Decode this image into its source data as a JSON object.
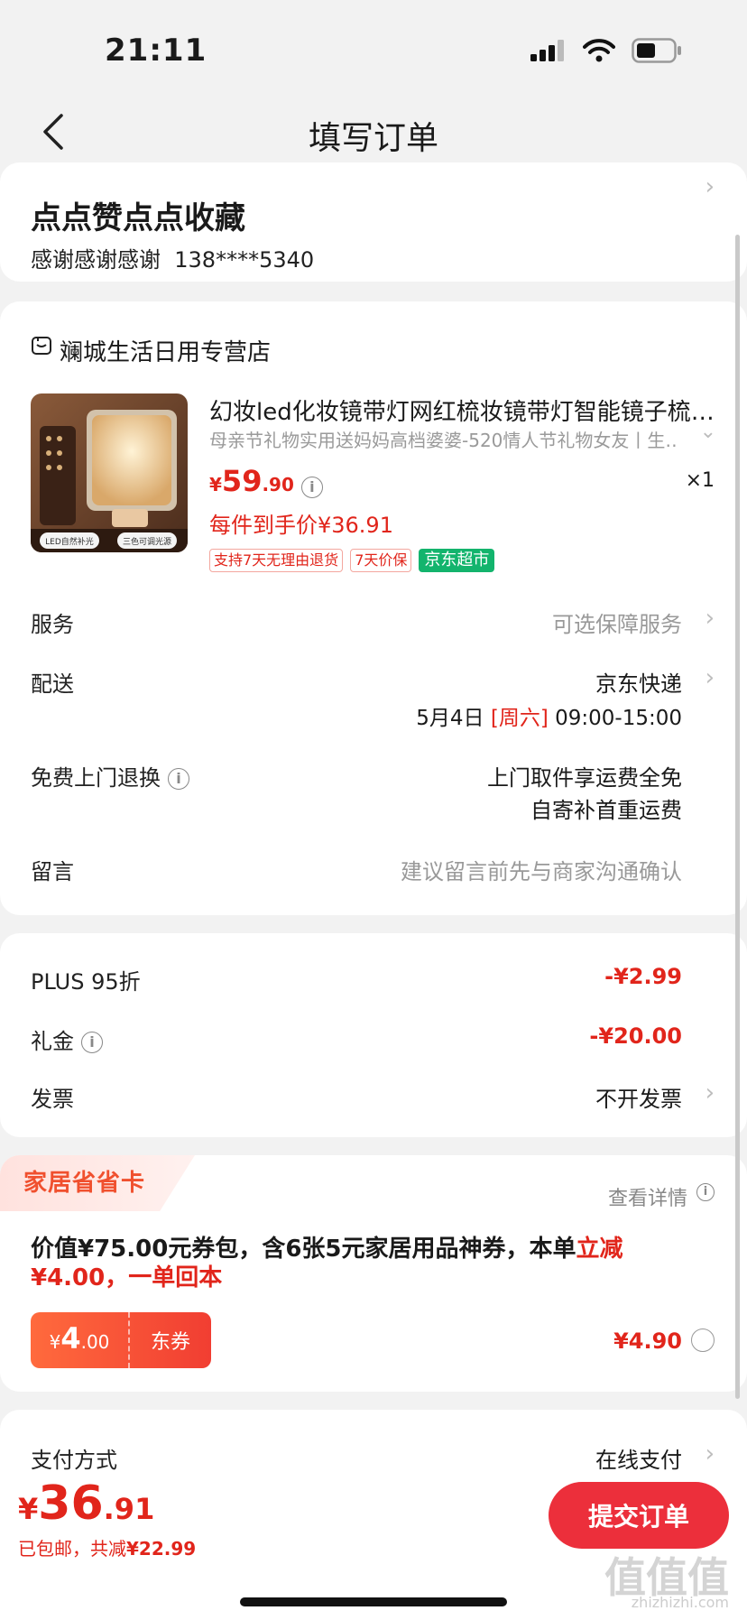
{
  "status": {
    "time": "21:11"
  },
  "nav": {
    "title": "填写订单"
  },
  "address": {
    "name": "点点赞点点收藏",
    "contact": "感谢感谢感谢",
    "phone": "138****5340"
  },
  "shop": {
    "name": "斓城生活日用专营店"
  },
  "product": {
    "title": "幻妆led化妆镜带灯网红梳妆镜带灯智能镜子梳…",
    "subtitle": "母亲节礼物实用送妈妈高档婆婆-520情人节礼物女友丨生…",
    "price_int": "59",
    "price_dec": ".90",
    "currency": "¥",
    "qty": "×1",
    "net_price": "每件到手价¥36.91",
    "tags": [
      "支持7天无理由退货",
      "7天价保"
    ],
    "tag_green": "京东超市",
    "image_labels": [
      "LED自然补光",
      "三色可调光源"
    ]
  },
  "rows": {
    "service": {
      "label": "服务",
      "value": "可选保障服务"
    },
    "delivery": {
      "label": "配送",
      "value": "京东快递",
      "date": "5月4日",
      "weekday": "[周六]",
      "time": "09:00-15:00"
    },
    "return": {
      "label": "免费上门退换",
      "line1": "上门取件享运费全免",
      "line2": "自寄补首重运费"
    },
    "message": {
      "label": "留言",
      "placeholder": "建议留言前先与商家沟通确认"
    }
  },
  "discounts": {
    "plus": {
      "label": "PLUS 95折",
      "value": "-¥2.99"
    },
    "gift": {
      "label": "礼金",
      "value": "-¥20.00"
    },
    "invoice": {
      "label": "发票",
      "value": "不开发票"
    }
  },
  "card": {
    "badge": "家居省省卡",
    "details": "查看详情",
    "promo_a": "价值¥75.00元券包，含6张5元家居用品神券，本单",
    "promo_b": "立减",
    "promo_c": "¥4.00，一单回本",
    "coupon_currency": "¥",
    "coupon_int": "4",
    "coupon_dec": ".00",
    "coupon_label": "东券",
    "price": "¥4.90"
  },
  "payment": {
    "label": "支付方式",
    "value": "在线支付"
  },
  "bottom": {
    "currency": "¥",
    "total_int": "36",
    "total_dec": ".91",
    "sub_a": "已包邮，",
    "sub_b": "共减",
    "sub_c": "¥22.99",
    "submit": "提交订单"
  },
  "watermark": {
    "main": "值值值",
    "sub": "zhizhizhi.com"
  },
  "colors": {
    "accent": "#e1251b",
    "submit": "#ec2f3b",
    "green_tag": "#13b46d"
  }
}
